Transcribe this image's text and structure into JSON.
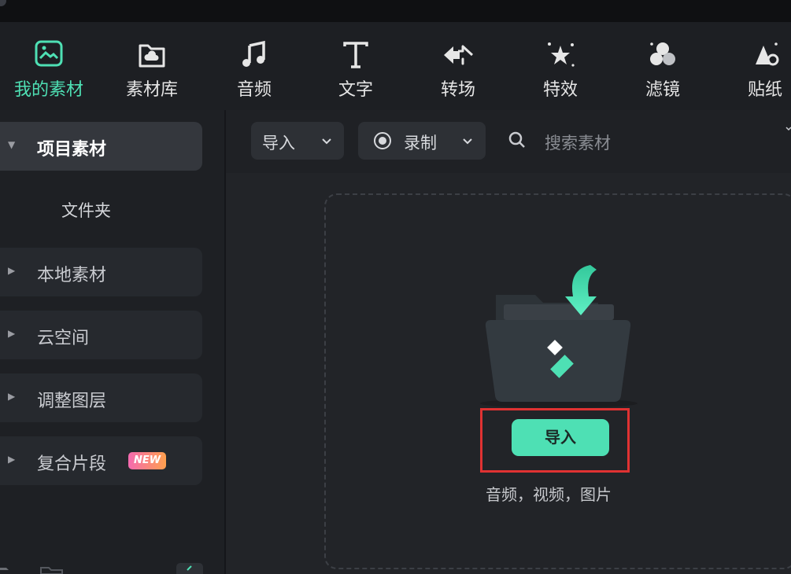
{
  "toolbar": {
    "items": [
      {
        "label": "我的素材",
        "icon": "media-icon",
        "active": true
      },
      {
        "label": "素材库",
        "icon": "cloud-folder-icon"
      },
      {
        "label": "音频",
        "icon": "music-note-icon"
      },
      {
        "label": "文字",
        "icon": "text-t-icon"
      },
      {
        "label": "转场",
        "icon": "transition-arrows-icon"
      },
      {
        "label": "特效",
        "icon": "sparkle-star-icon"
      },
      {
        "label": "滤镜",
        "icon": "filter-circles-icon"
      },
      {
        "label": "贴纸",
        "icon": "sticker-icon"
      }
    ]
  },
  "sidebar": {
    "project_media": "项目素材",
    "folder": "文件夹",
    "local_media": "本地素材",
    "cloud_space": "云空间",
    "adjustment_layer": "调整图层",
    "compound_clip": "复合片段",
    "new_badge": "NEW"
  },
  "topbar": {
    "import_label": "导入",
    "record_label": "录制",
    "search_placeholder": "搜索素材"
  },
  "dropzone": {
    "import_button": "导入",
    "hint": "音频，视频，图片"
  },
  "colors": {
    "accent": "#4ee0b4",
    "highlight_box": "#e03232",
    "background": "#1b1d20"
  }
}
